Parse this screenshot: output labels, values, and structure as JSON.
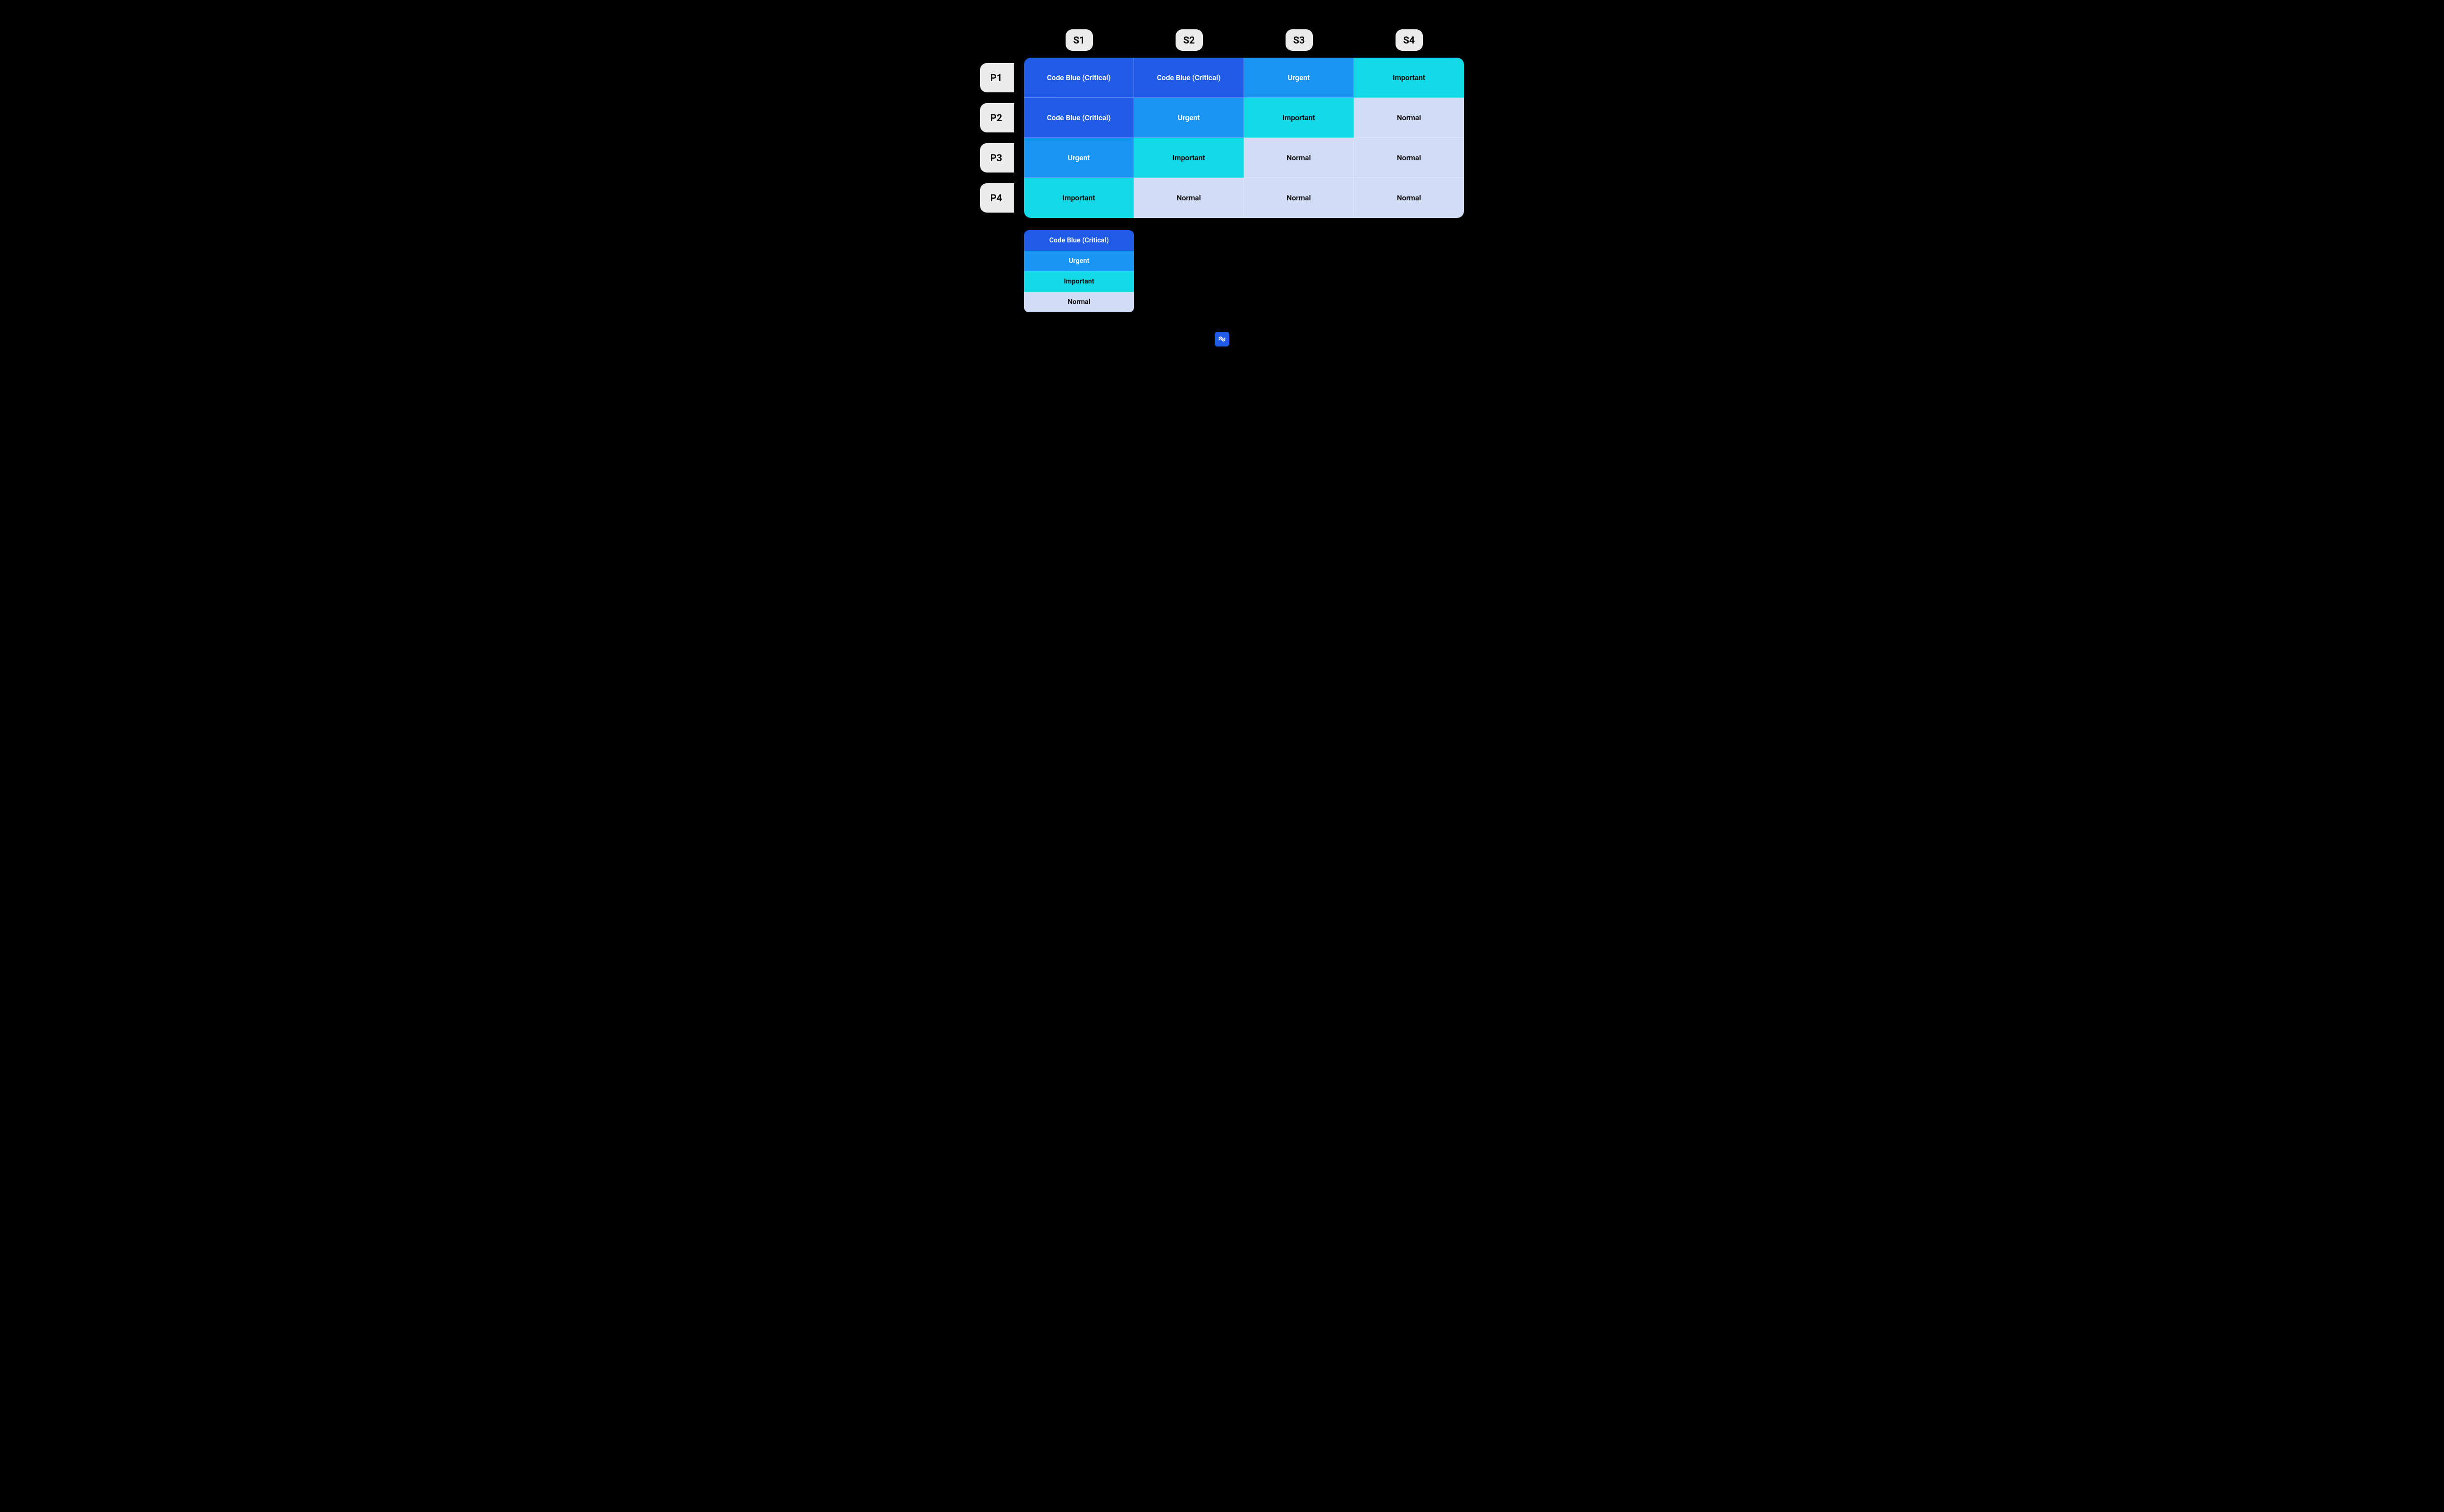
{
  "columns": [
    "S1",
    "S2",
    "S3",
    "S4"
  ],
  "rows": [
    "P1",
    "P2",
    "P3",
    "P4"
  ],
  "levels": {
    "critical": {
      "label": "Code Blue (Critical)",
      "class": "lvl-critical"
    },
    "urgent": {
      "label": "Urgent",
      "class": "lvl-urgent"
    },
    "important": {
      "label": "Important",
      "class": "lvl-important"
    },
    "normal": {
      "label": "Normal",
      "class": "lvl-normal"
    }
  },
  "matrix": [
    [
      "critical",
      "critical",
      "urgent",
      "important"
    ],
    [
      "critical",
      "urgent",
      "important",
      "normal"
    ],
    [
      "urgent",
      "important",
      "normal",
      "normal"
    ],
    [
      "important",
      "normal",
      "normal",
      "normal"
    ]
  ],
  "legend_order": [
    "critical",
    "urgent",
    "important",
    "normal"
  ],
  "chart_data": {
    "type": "table",
    "title": "",
    "row_labels": [
      "P1",
      "P2",
      "P3",
      "P4"
    ],
    "col_labels": [
      "S1",
      "S2",
      "S3",
      "S4"
    ],
    "cells": [
      [
        "Code Blue (Critical)",
        "Code Blue (Critical)",
        "Urgent",
        "Important"
      ],
      [
        "Code Blue (Critical)",
        "Urgent",
        "Important",
        "Normal"
      ],
      [
        "Urgent",
        "Important",
        "Normal",
        "Normal"
      ],
      [
        "Important",
        "Normal",
        "Normal",
        "Normal"
      ]
    ],
    "legend": [
      "Code Blue (Critical)",
      "Urgent",
      "Important",
      "Normal"
    ]
  }
}
